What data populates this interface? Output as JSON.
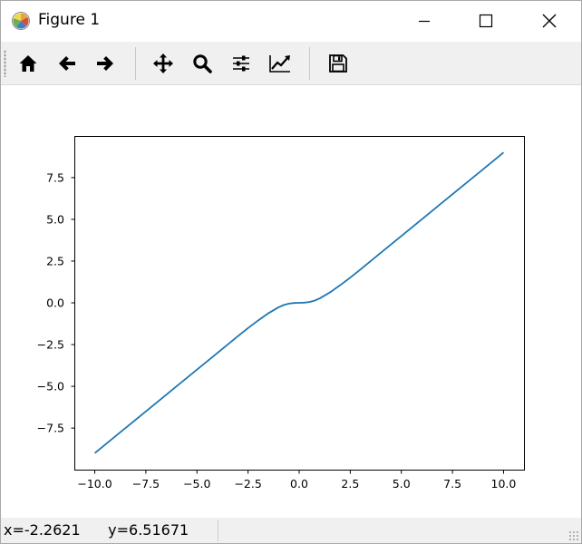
{
  "window": {
    "title": "Figure 1",
    "controls": [
      "minimize",
      "maximize",
      "close"
    ]
  },
  "toolbar": {
    "buttons": [
      {
        "name": "home",
        "icon": "home-icon"
      },
      {
        "name": "back",
        "icon": "arrow-left-icon"
      },
      {
        "name": "forward",
        "icon": "arrow-right-icon"
      },
      {
        "name": "pan",
        "icon": "move-icon"
      },
      {
        "name": "zoom",
        "icon": "magnifier-icon"
      },
      {
        "name": "subplots",
        "icon": "sliders-icon"
      },
      {
        "name": "customize",
        "icon": "line-chart-icon"
      },
      {
        "name": "save",
        "icon": "floppy-disk-icon"
      }
    ]
  },
  "chart_data": {
    "type": "line",
    "title": "",
    "xlabel": "",
    "ylabel": "",
    "xlim": [
      -11.0,
      11.0
    ],
    "ylim": [
      -9.99,
      9.99
    ],
    "xticks": [
      -10.0,
      -7.5,
      -5.0,
      -2.5,
      0.0,
      2.5,
      5.0,
      7.5,
      10.0
    ],
    "xtick_labels": [
      "−10.0",
      "−7.5",
      "−5.0",
      "−2.5",
      "0.0",
      "2.5",
      "5.0",
      "7.5",
      "10.0"
    ],
    "yticks": [
      -7.5,
      -5.0,
      -2.5,
      0.0,
      2.5,
      5.0,
      7.5
    ],
    "ytick_labels": [
      "−7.5",
      "−5.0",
      "−2.5",
      "0.0",
      "2.5",
      "5.0",
      "7.5"
    ],
    "grid": false,
    "legend": "none",
    "line_color": "#1f77b4",
    "series": [
      {
        "x": [
          -10.0,
          -9.0,
          -8.0,
          -7.0,
          -6.0,
          -5.0,
          -4.0,
          -3.0,
          -2.5,
          -2.0,
          -1.5,
          -1.0,
          -0.75,
          -0.5,
          -0.25,
          0.0,
          0.25,
          0.5,
          0.75,
          1.0,
          1.5,
          2.0,
          2.5,
          3.0,
          4.0,
          5.0,
          6.0,
          7.0,
          8.0,
          9.0,
          10.0
        ],
        "y": [
          -9.0,
          -8.0,
          -7.0,
          -6.0,
          -5.0,
          -4.0,
          -3.0,
          -2.0,
          -1.51,
          -1.05,
          -0.62,
          -0.26,
          -0.13,
          -0.05,
          -0.01,
          0.0,
          0.01,
          0.05,
          0.13,
          0.26,
          0.62,
          1.05,
          1.51,
          2.0,
          3.0,
          4.0,
          5.0,
          6.0,
          7.0,
          8.0,
          9.0
        ]
      }
    ]
  },
  "status": {
    "text": "x=-2.2621      y=6.51671"
  }
}
